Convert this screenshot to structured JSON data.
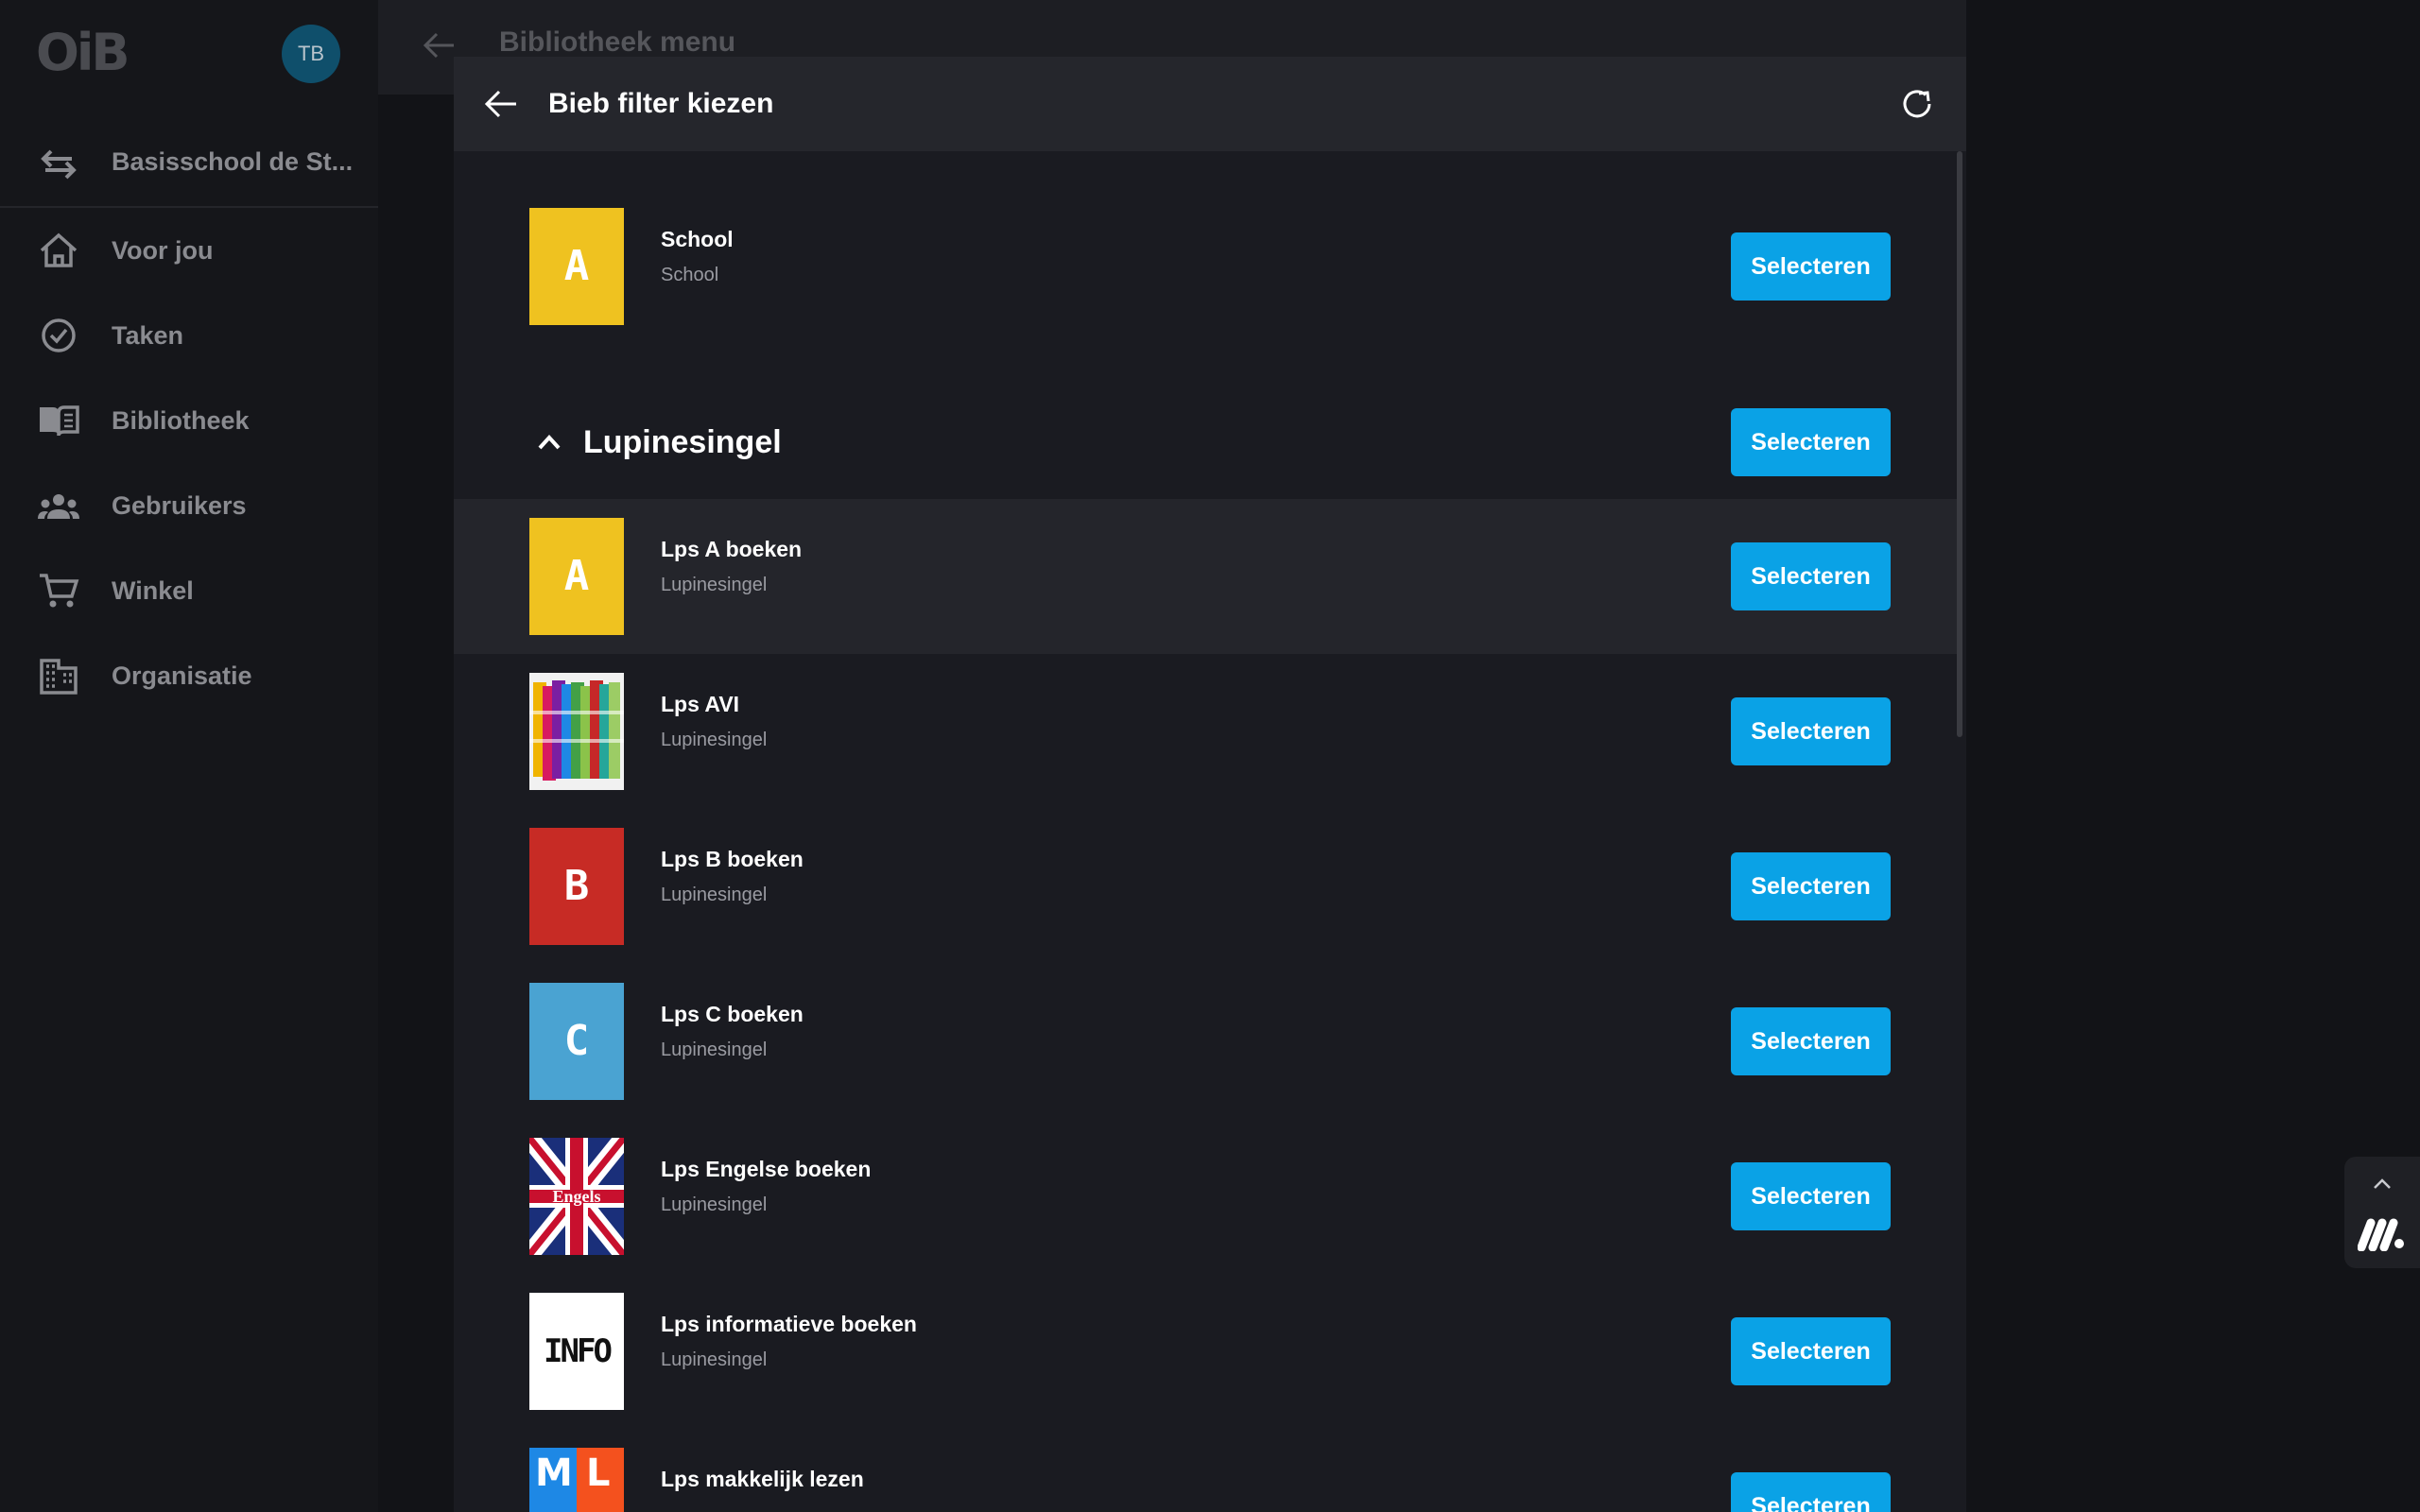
{
  "sidebar": {
    "logo": "OiB",
    "avatar_initials": "TB",
    "school_switch": "Basisschool de St...",
    "items": [
      {
        "label": "Voor jou",
        "icon": "home-icon"
      },
      {
        "label": "Taken",
        "icon": "check-circle-icon"
      },
      {
        "label": "Bibliotheek",
        "icon": "book-open-icon"
      },
      {
        "label": "Gebruikers",
        "icon": "users-icon"
      },
      {
        "label": "Winkel",
        "icon": "cart-icon"
      },
      {
        "label": "Organisatie",
        "icon": "building-icon"
      }
    ]
  },
  "background": {
    "title": "Bibliotheek menu"
  },
  "dialog": {
    "title": "Bieb filter kiezen",
    "select_label": "Selecteren",
    "school_row": {
      "title": "School",
      "subtitle": "School",
      "thumb": "A",
      "color": "#efc220"
    },
    "group": {
      "title": "Lupinesingel"
    },
    "items": [
      {
        "title": "Lps A boeken",
        "subtitle": "Lupinesingel",
        "thumb": "A",
        "type": "letter",
        "color": "#efc220"
      },
      {
        "title": "Lps AVI",
        "subtitle": "Lupinesingel",
        "thumb": "",
        "type": "avi-image"
      },
      {
        "title": "Lps B boeken",
        "subtitle": "Lupinesingel",
        "thumb": "B",
        "type": "letter",
        "color": "#c72b25"
      },
      {
        "title": "Lps C boeken",
        "subtitle": "Lupinesingel",
        "thumb": "C",
        "type": "letter",
        "color": "#4aa3d2"
      },
      {
        "title": "Lps Engelse boeken",
        "subtitle": "Lupinesingel",
        "thumb": "Engels",
        "type": "uk-flag"
      },
      {
        "title": "Lps informatieve boeken",
        "subtitle": "Lupinesingel",
        "thumb": "INFO",
        "type": "info"
      },
      {
        "title": "Lps makkelijk lezen",
        "subtitle": "",
        "thumb": "ML",
        "type": "ml-image"
      }
    ]
  },
  "colors": {
    "accent": "#0aa2e6",
    "dialog_bg": "#1a1b21",
    "header_bg": "#25262c",
    "sidebar_bg": "#15161a"
  }
}
